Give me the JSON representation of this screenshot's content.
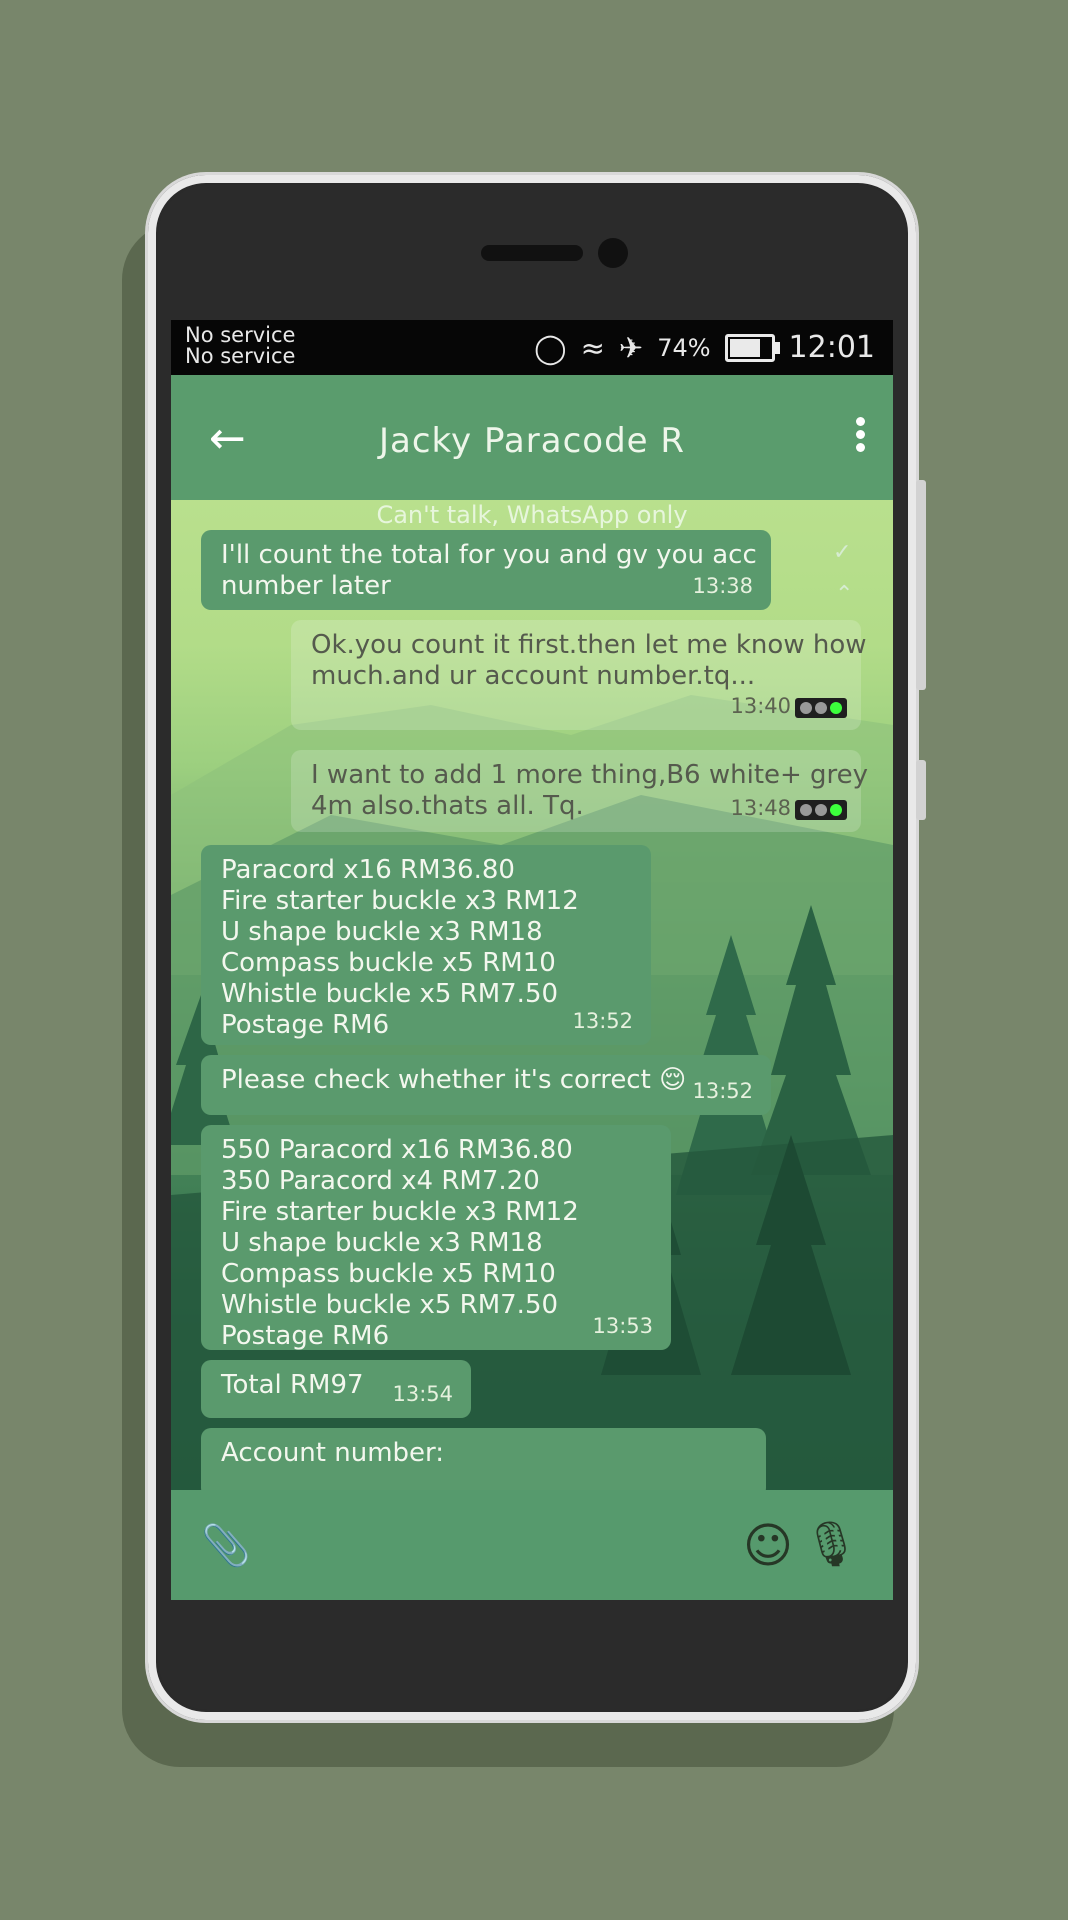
{
  "status_bar": {
    "service_line_1": "No service",
    "service_line_2": "No service",
    "battery": "74%",
    "time": "12:01"
  },
  "header": {
    "back_icon": "arrow-left-icon",
    "title": "Jacky Paracode R",
    "menu_icon": "more-vert-icon"
  },
  "subtitle": "Can't talk, WhatsApp only",
  "messages": [
    {
      "dir": "in",
      "lines": [
        "I'll count the total for you and gv you acc",
        "number later"
      ],
      "time": "13:38"
    },
    {
      "dir": "out",
      "lines": [
        "Ok.you count it first.then let me know how",
        "much.and ur account number.tq..."
      ],
      "time": "13:40"
    },
    {
      "dir": "out",
      "lines": [
        "I want to add 1 more thing,B6 white+ grey",
        "4m also.thats all. Tq."
      ],
      "time": "13:48"
    },
    {
      "dir": "in",
      "lines": [
        "Paracord x16 RM36.80",
        "Fire starter buckle x3 RM12",
        "U shape buckle x3 RM18",
        "Compass buckle x5 RM10",
        "Whistle buckle x5 RM7.50",
        "Postage RM6"
      ],
      "time": "13:52"
    },
    {
      "dir": "in",
      "lines": [
        "Please check whether it's correct 😌"
      ],
      "time": "13:52"
    },
    {
      "dir": "in",
      "lines": [
        "550 Paracord x16 RM36.80",
        "350 Paracord x4 RM7.20",
        "Fire starter buckle x3 RM12",
        "U shape buckle x3 RM18",
        "Compass buckle x5 RM10",
        "Whistle buckle x5 RM7.50",
        "Postage RM6"
      ],
      "time": "13:53"
    },
    {
      "dir": "in",
      "lines": [
        "Total RM97"
      ],
      "time": "13:54"
    },
    {
      "dir": "in",
      "lines": [
        "Account number:"
      ],
      "time": ""
    }
  ],
  "input_bar": {
    "attach_icon": "paperclip-icon",
    "emoji_icon": "emoji-icon",
    "mic_icon": "microphone-icon"
  }
}
